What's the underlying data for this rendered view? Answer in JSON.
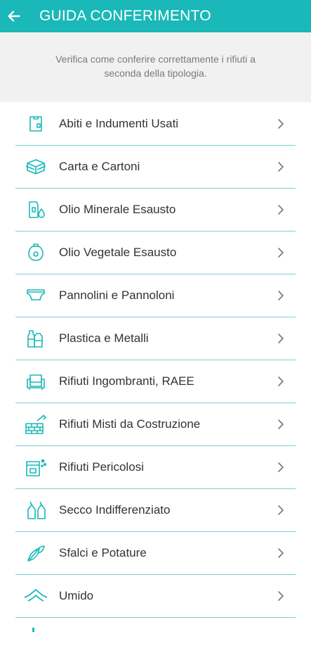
{
  "header": {
    "title": "GUIDA CONFERIMENTO",
    "back_icon": "arrow-left-icon",
    "accent_color": "#1ab8b8"
  },
  "intro": {
    "text": "Verifica come conferire correttamente i rifiuti a seconda della tipologia."
  },
  "categories": [
    {
      "label": "Abiti e Indumenti Usati",
      "icon": "clothing-tag-icon"
    },
    {
      "label": "Carta e Cartoni",
      "icon": "cardboard-box-icon"
    },
    {
      "label": "Olio Minerale Esausto",
      "icon": "oil-can-icon"
    },
    {
      "label": "Olio Vegetale Esausto",
      "icon": "vegetable-oil-icon"
    },
    {
      "label": "Pannolini e Pannoloni",
      "icon": "diaper-icon"
    },
    {
      "label": "Plastica e Metalli",
      "icon": "bottles-icon"
    },
    {
      "label": "Rifiuti Ingombranti, RAEE",
      "icon": "armchair-icon"
    },
    {
      "label": "Rifiuti Misti da Costruzione",
      "icon": "bricks-trowel-icon"
    },
    {
      "label": "Rifiuti Pericolosi",
      "icon": "hazard-container-icon"
    },
    {
      "label": "Secco Indifferenziato",
      "icon": "trash-bags-icon"
    },
    {
      "label": "Sfalci e Potature",
      "icon": "leaves-icon"
    },
    {
      "label": "Umido",
      "icon": "organic-waste-icon"
    }
  ]
}
